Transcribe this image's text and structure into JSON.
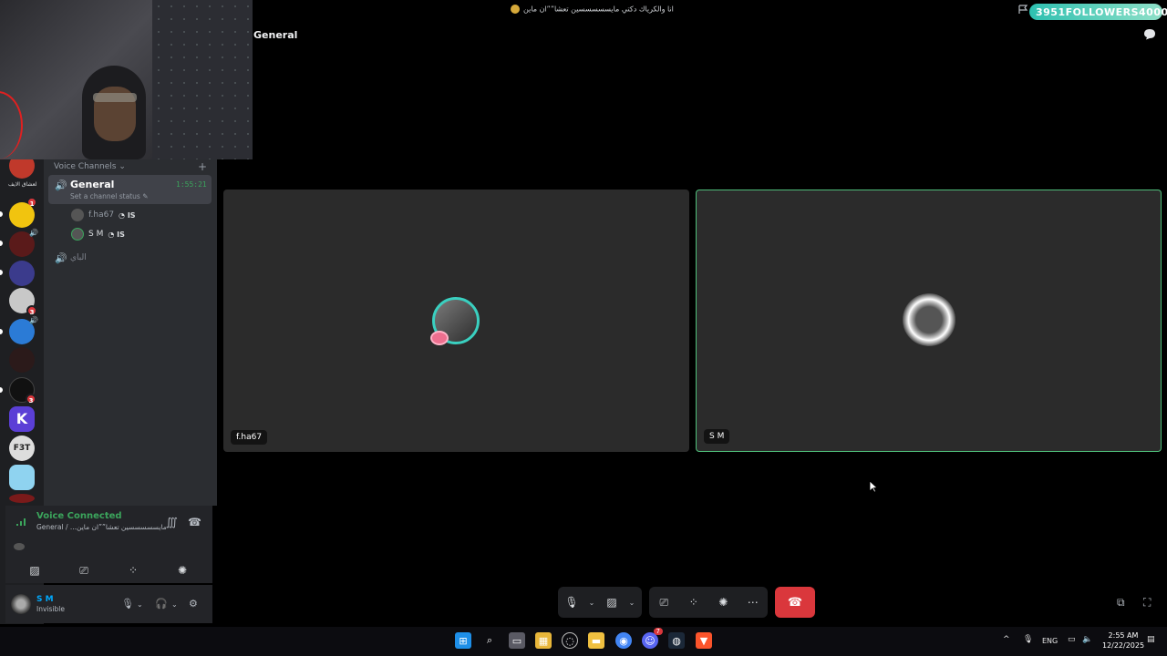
{
  "top": {
    "title": "انا والكرياك دكتي مايسسسسسين تعشا””ان ماين",
    "channel_header": "General",
    "followers_count": "3951",
    "followers_label": "FOLLOWERS",
    "followers_goal": "4000"
  },
  "rail": {
    "server_label_1": "لعشاق الايف",
    "badges": [
      "1",
      "3",
      "3"
    ],
    "fbt_label": "F3T"
  },
  "sidebar": {
    "voice_channels_label": "Voice Channels",
    "add_icon": "+",
    "general": {
      "name": "General",
      "status": "Set a channel status",
      "timer": "1:55:21"
    },
    "users": [
      {
        "name": "f.ha67",
        "tag": "IS"
      },
      {
        "name": "S M",
        "tag": "IS"
      }
    ],
    "other_channel": "الباي"
  },
  "voice_panel": {
    "status": "Voice Connected",
    "sub": "General / ...مايسسسسسين تعشا””ان ماين"
  },
  "user_panel": {
    "name": "S M",
    "status": "Invisible"
  },
  "tiles": [
    {
      "name": "f.ha67"
    },
    {
      "name": "S M"
    }
  ],
  "taskbar": {
    "lang": "ENG",
    "time": "2:55 AM",
    "date": "12/22/2025",
    "discord_badge": "7"
  },
  "colors": {
    "accent_green": "#3ba55c",
    "end_call_red": "#da373c",
    "followers_teal": "#2ec0b0",
    "speaking_border": "#4fbf7a"
  }
}
